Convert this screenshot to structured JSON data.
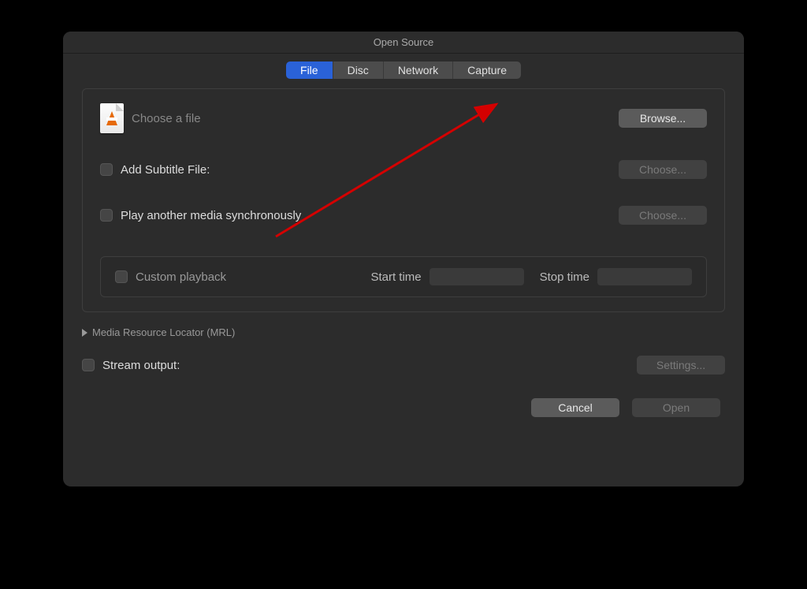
{
  "window": {
    "title": "Open Source"
  },
  "tabs": {
    "file": "File",
    "disc": "Disc",
    "network": "Network",
    "capture": "Capture"
  },
  "file_chooser": {
    "placeholder": "Choose a file",
    "browse_label": "Browse..."
  },
  "subtitle": {
    "label": "Add Subtitle File:",
    "choose_label": "Choose..."
  },
  "sync_media": {
    "label": "Play another media synchronously",
    "choose_label": "Choose..."
  },
  "custom_playback": {
    "label": "Custom playback",
    "start_label": "Start time",
    "stop_label": "Stop time"
  },
  "mrl": {
    "label": "Media Resource Locator (MRL)"
  },
  "stream": {
    "label": "Stream output:",
    "settings_label": "Settings..."
  },
  "footer": {
    "cancel_label": "Cancel",
    "open_label": "Open"
  }
}
